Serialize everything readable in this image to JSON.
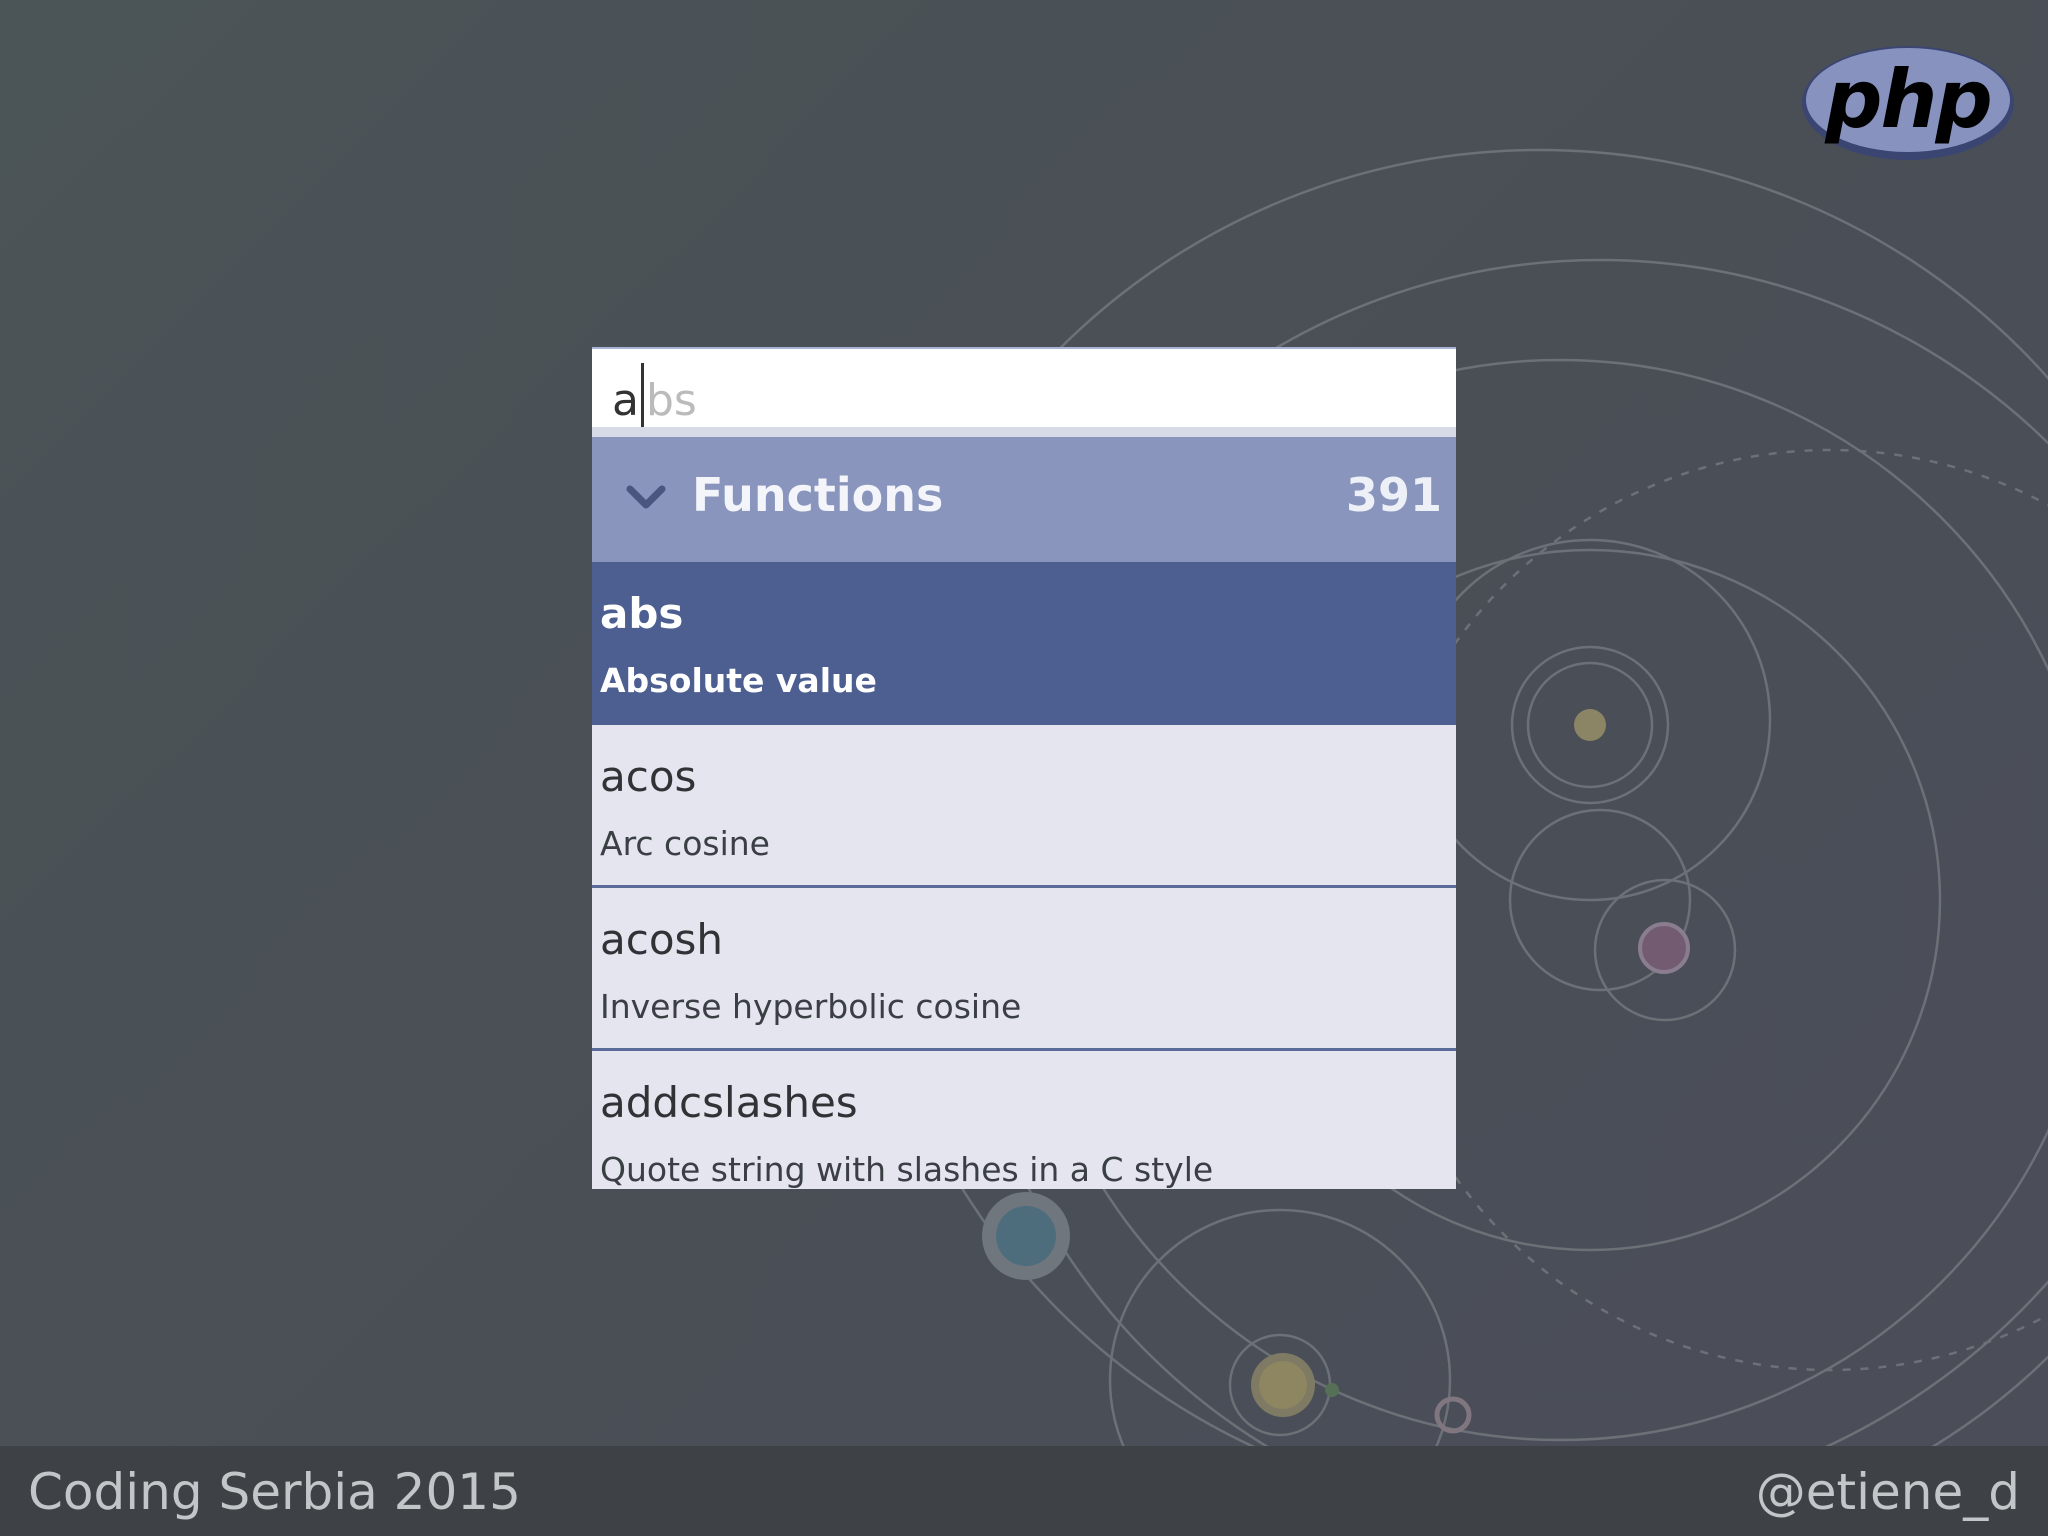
{
  "logo": {
    "text": "php",
    "color": "#8892bf"
  },
  "search": {
    "typed": "a",
    "autocomplete_rest": "bs"
  },
  "group": {
    "title": "Functions",
    "count": "391",
    "icon": "chevron-down-icon"
  },
  "results": [
    {
      "name": "abs",
      "description": "Absolute value",
      "selected": true
    },
    {
      "name": "acos",
      "description": "Arc cosine",
      "selected": false
    },
    {
      "name": "acosh",
      "description": "Inverse hyperbolic cosine",
      "selected": false
    },
    {
      "name": "addcslashes",
      "description": "Quote string with slashes in a C style",
      "selected": false
    }
  ],
  "footer": {
    "left": "Coding Serbia 2015",
    "right": "@etiene_d"
  },
  "colors": {
    "header": "#8995bd",
    "selected": "#4d5e91",
    "item_bg": "#e4e5ef"
  }
}
